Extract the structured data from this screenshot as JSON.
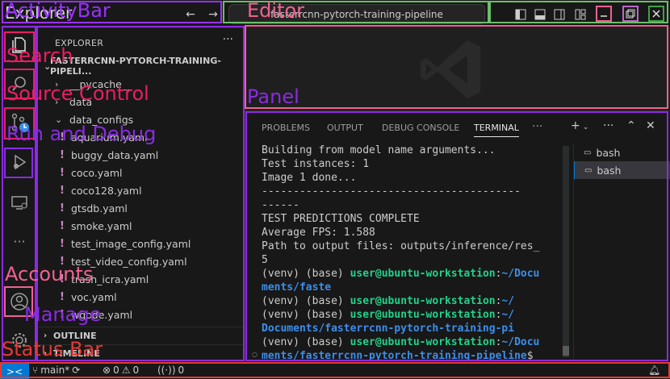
{
  "titlebar": {
    "menu_label": "Explorer",
    "search_text": "fasterrcnn-pytorch-training-pipeline",
    "back_icon": "arrow-left-icon",
    "forward_icon": "arrow-right-icon"
  },
  "sidebar": {
    "title": "EXPLORER",
    "more": "···",
    "root": "FASTERRCNN-PYTORCH-TRAINING-PIPELI...",
    "items": [
      {
        "label": "__pycache__",
        "kind": "folder"
      },
      {
        "label": "data",
        "kind": "folder"
      },
      {
        "label": "data_configs",
        "kind": "folder-open"
      },
      {
        "label": "aquarium.yaml",
        "kind": "yaml"
      },
      {
        "label": "buggy_data.yaml",
        "kind": "yaml"
      },
      {
        "label": "coco.yaml",
        "kind": "yaml"
      },
      {
        "label": "coco128.yaml",
        "kind": "yaml"
      },
      {
        "label": "gtsdb.yaml",
        "kind": "yaml"
      },
      {
        "label": "smoke.yaml",
        "kind": "yaml"
      },
      {
        "label": "test_image_config.yaml",
        "kind": "yaml"
      },
      {
        "label": "test_video_config.yaml",
        "kind": "yaml"
      },
      {
        "label": "trash_icra.yaml",
        "kind": "yaml"
      },
      {
        "label": "voc.yaml",
        "kind": "yaml"
      },
      {
        "label": "wgode.yaml",
        "kind": "yaml"
      }
    ],
    "outline": "OUTLINE",
    "timeline": "TIMELINE"
  },
  "panel": {
    "tabs": [
      "PROBLEMS",
      "OUTPUT",
      "DEBUG CONSOLE",
      "TERMINAL"
    ],
    "active_tab": "TERMINAL",
    "terminal_lines": [
      {
        "t": "Building from model name arguments..."
      },
      {
        "t": "Test instances: 1"
      },
      {
        "t": "Image 1 done..."
      },
      {
        "t": "-----------------------------------------"
      },
      {
        "t": "------"
      },
      {
        "t": "TEST PREDICTIONS COMPLETE"
      },
      {
        "t": "Average FPS: 1.588"
      },
      {
        "t": "Path to output files: outputs/inference/res_"
      },
      {
        "t": "5"
      },
      {
        "env": "(venv) (base) ",
        "user": "user@ubuntu-workstation",
        "sep": ":",
        "path": "~/Docu"
      },
      {
        "path": "ments/faste"
      },
      {
        "env": "(venv) (base) ",
        "user": "user@ubuntu-workstation",
        "sep": ":",
        "path": "~/"
      },
      {
        "env": "(venv) (base) ",
        "user": "user@ubuntu-workstation",
        "sep": ":",
        "path": "~/"
      },
      {
        "path": "Documents/fasterrcnn-pytorch-training-pi"
      },
      {
        "env": "(venv) (base) ",
        "user": "user@ubuntu-workstation",
        "sep": ":",
        "path": "~/Docu"
      },
      {
        "path": "ments/fasterrcnn-pytorch-training-pipeline",
        "tail": "$"
      }
    ],
    "terminals": [
      "bash",
      "bash"
    ]
  },
  "statusbar": {
    "branch": "main*",
    "errors": "0",
    "warnings": "0",
    "ports": "0"
  },
  "overlays": [
    {
      "label": "ActivityBar",
      "color": "#9b30ff"
    },
    {
      "label": "Editor",
      "color": "#f06292"
    },
    {
      "label": "Search",
      "color": "#e91e63"
    },
    {
      "label": "Source Control",
      "color": "#e91e63"
    },
    {
      "label": "Panel",
      "color": "#8a2be2"
    },
    {
      "label": "Run and Debug",
      "color": "#8a2be2"
    },
    {
      "label": "Accounts",
      "color": "#f06292"
    },
    {
      "label": "Manage",
      "color": "#8a2be2"
    },
    {
      "label": "Status Bar",
      "color": "#e53935"
    }
  ]
}
